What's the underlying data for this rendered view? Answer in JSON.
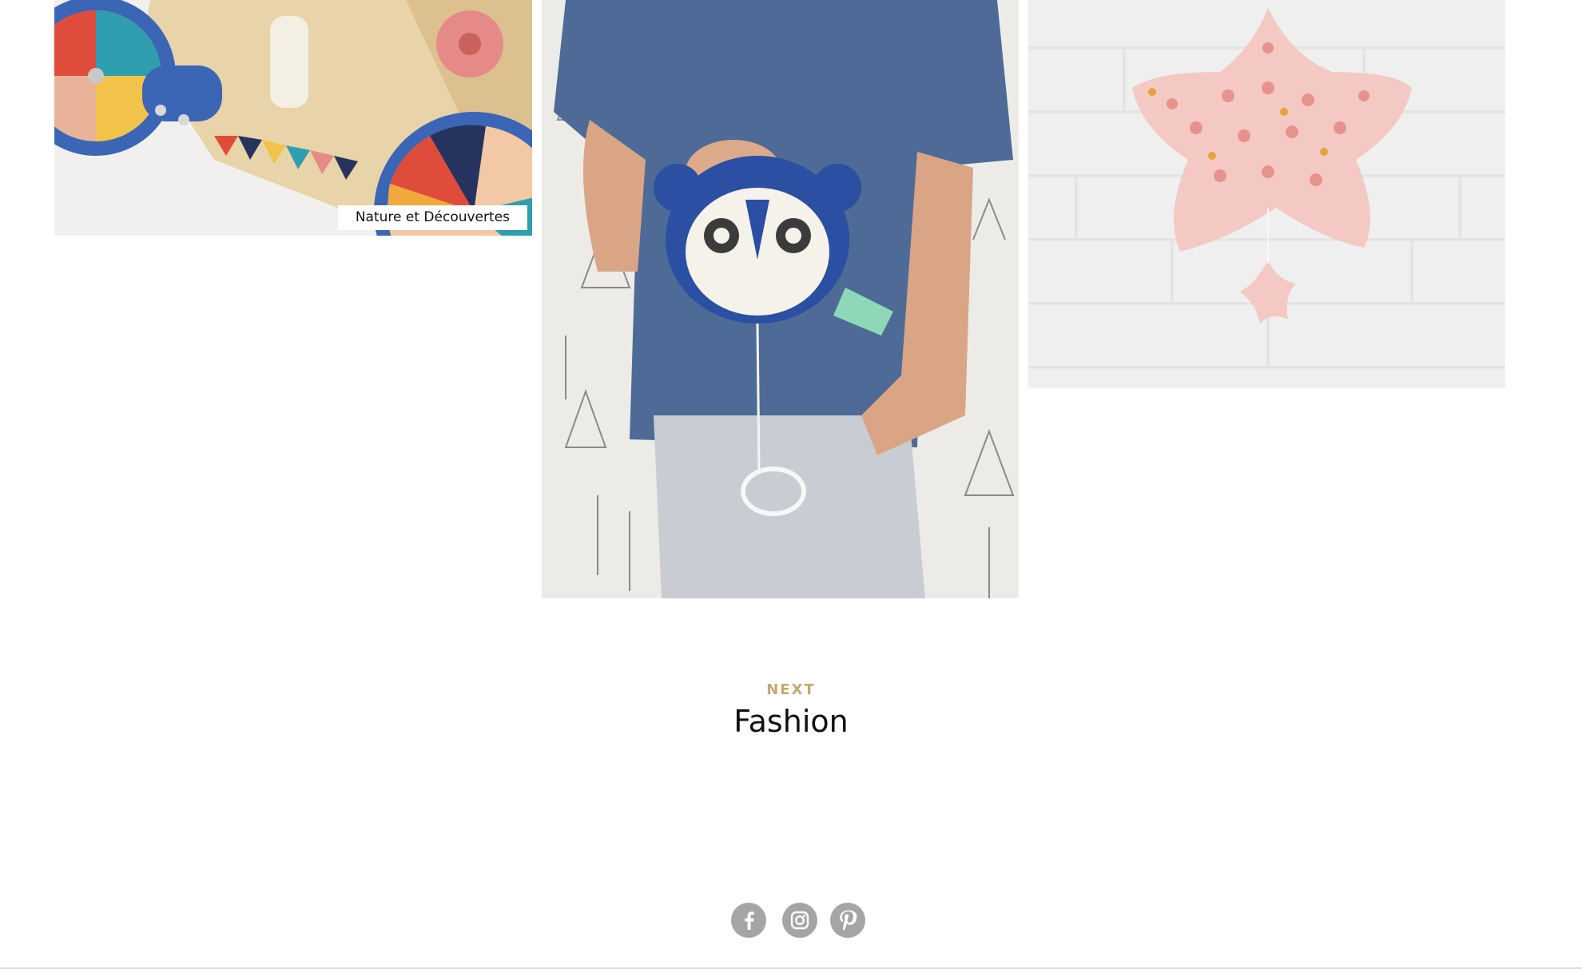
{
  "gallery": {
    "tiles": [
      {
        "subject": "wooden activity walker toy",
        "caption": "Nature et Découvertes"
      },
      {
        "subject": "child holding blue raccoon musical plush"
      },
      {
        "subject": "pink star musical mobile"
      }
    ]
  },
  "next": {
    "label": "NEXT",
    "title": "Fashion"
  },
  "social": {
    "icons": [
      "facebook-icon",
      "instagram-icon",
      "pinterest-icon"
    ]
  },
  "colors": {
    "accent": "#c4a86e",
    "text": "#111111",
    "icon_bg": "#a5a5a5"
  }
}
